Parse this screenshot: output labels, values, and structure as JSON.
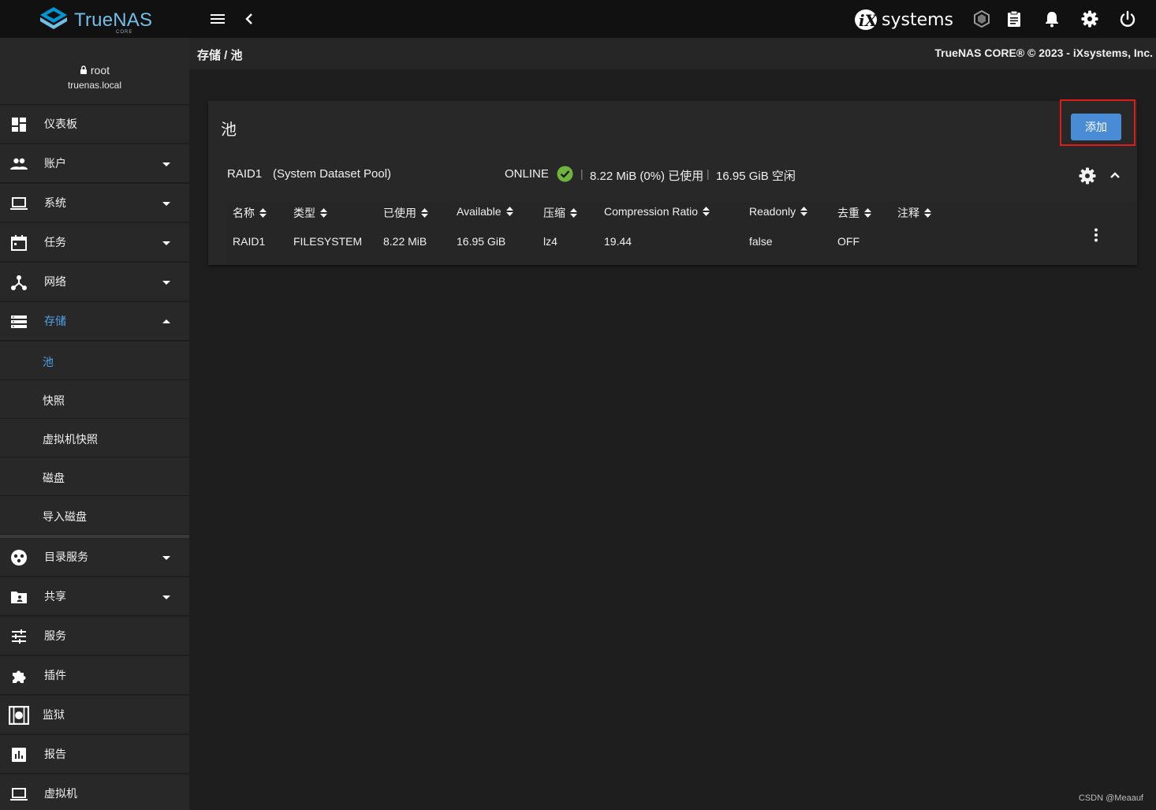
{
  "topbar": {
    "logo_text": "TrueNAS",
    "logo_sub": "CORE",
    "vendor_logo_text": "systems",
    "icons": [
      "menu-icon",
      "chevron-left-icon",
      "truecommand-icon",
      "clipboard-icon",
      "bell-icon",
      "gear-icon",
      "power-icon"
    ]
  },
  "breadcrumb": {
    "text": "存储 /  池"
  },
  "copyright": "TrueNAS CORE® © 2023 - iXsystems, Inc.",
  "user": {
    "name": "root",
    "host": "truenas.local"
  },
  "sidebar": {
    "items": [
      {
        "label": "仪表板",
        "icon": "dashboard-icon"
      },
      {
        "label": "账户",
        "icon": "people-icon"
      },
      {
        "label": "系统",
        "icon": "laptop-icon"
      },
      {
        "label": "任务",
        "icon": "calendar-icon"
      },
      {
        "label": "网络",
        "icon": "network-icon"
      },
      {
        "label": "存储",
        "icon": "storage-icon"
      },
      {
        "label": "目录服务",
        "icon": "directory-icon"
      },
      {
        "label": "共享",
        "icon": "share-folder-icon"
      },
      {
        "label": "服务",
        "icon": "tune-icon"
      },
      {
        "label": "插件",
        "icon": "puzzle-icon"
      },
      {
        "label": "监狱",
        "icon": "jail-icon"
      },
      {
        "label": "报告",
        "icon": "chart-icon"
      },
      {
        "label": "虚拟机",
        "icon": "computer-icon"
      }
    ],
    "storage_sub": [
      {
        "label": "池"
      },
      {
        "label": "快照"
      },
      {
        "label": "虚拟机快照"
      },
      {
        "label": "磁盘"
      },
      {
        "label": "导入磁盘"
      }
    ]
  },
  "card": {
    "title": "池",
    "add_label": "添加",
    "pool": {
      "name": "RAID1",
      "desc": "(System Dataset Pool)",
      "status": "ONLINE",
      "used": "8.22 MiB (0%) 已使用",
      "free": "16.95 GiB 空闲",
      "separator": "|"
    },
    "columns": [
      "名称",
      "类型",
      "已使用",
      "Available",
      "压缩",
      "Compression Ratio",
      "Readonly",
      "去重",
      "注释"
    ],
    "rows": [
      [
        "RAID1",
        "FILESYSTEM",
        "8.22 MiB",
        "16.95 GiB",
        "lz4",
        "19.44",
        "false",
        "OFF",
        ""
      ]
    ]
  },
  "colors": {
    "accent": "#4a8bd6",
    "active_text": "#4ea3e8",
    "status_ok": "#6fb43f",
    "highlight": "#e01919"
  },
  "watermark": "CSDN @Meaauf"
}
